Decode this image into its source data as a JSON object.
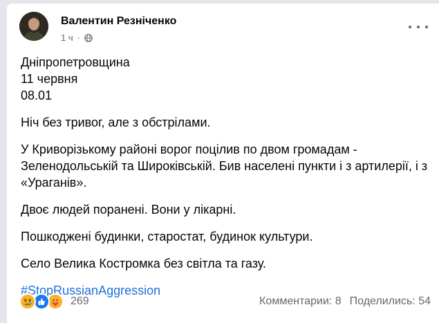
{
  "post": {
    "author": "Валентин Резніченко",
    "time": "1 ч",
    "separator": "·",
    "lines": {
      "region": "Дніпропетровщина",
      "date": "11 червня",
      "clock": "08.01"
    },
    "paragraphs": [
      "Ніч без тривог, але з обстрілами.",
      "У Криворізькому районі ворог поцілив по двом громадам - Зеленодольській та Широківській. Бив населені пункти і з артилерії, і з «Ураганів».",
      "Двоє людей поранені. Вони у лікарні.",
      "Пошкоджені  будинки, старостат, будинок культури.",
      "Село Велика Костромка без світла та газу."
    ],
    "hashtag": "#StopRussianAggression"
  },
  "footer": {
    "reaction_icons": [
      "sad-reaction-icon",
      "like-reaction-icon",
      "care-reaction-icon"
    ],
    "reaction_count": "269",
    "comments": "Комментарии: 8",
    "shares": "Поделились: 54"
  },
  "colors": {
    "link": "#216fdb",
    "secondary_text": "#65676b",
    "like_blue": "#1877f2",
    "sad_yellow": "#f7b125"
  }
}
